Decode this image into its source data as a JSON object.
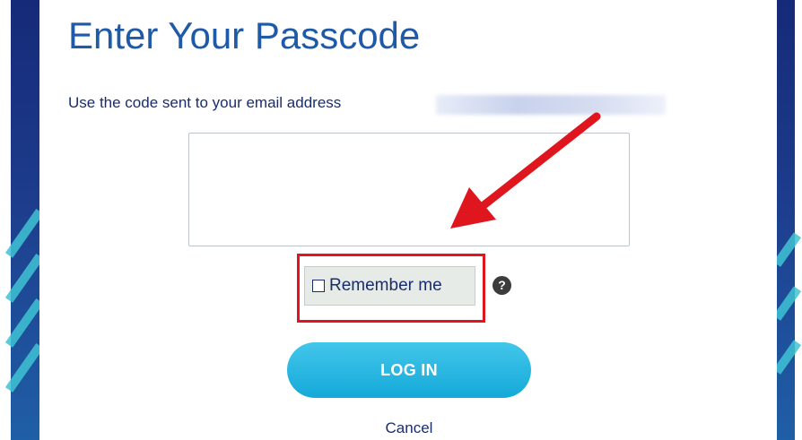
{
  "page": {
    "title": "Enter Your Passcode",
    "instruction": "Use the code sent to your email address"
  },
  "form": {
    "code_value": "",
    "remember_label": "Remember me",
    "help_glyph": "?",
    "login_label": "LOG IN",
    "cancel_label": "Cancel"
  },
  "annotations": {
    "arrow_color": "#e0161f",
    "highlight_color": "#e0161f"
  },
  "colors": {
    "title": "#1e5aa8",
    "login_button": "#1aaedd",
    "side_panel": "#1d3c8c"
  }
}
